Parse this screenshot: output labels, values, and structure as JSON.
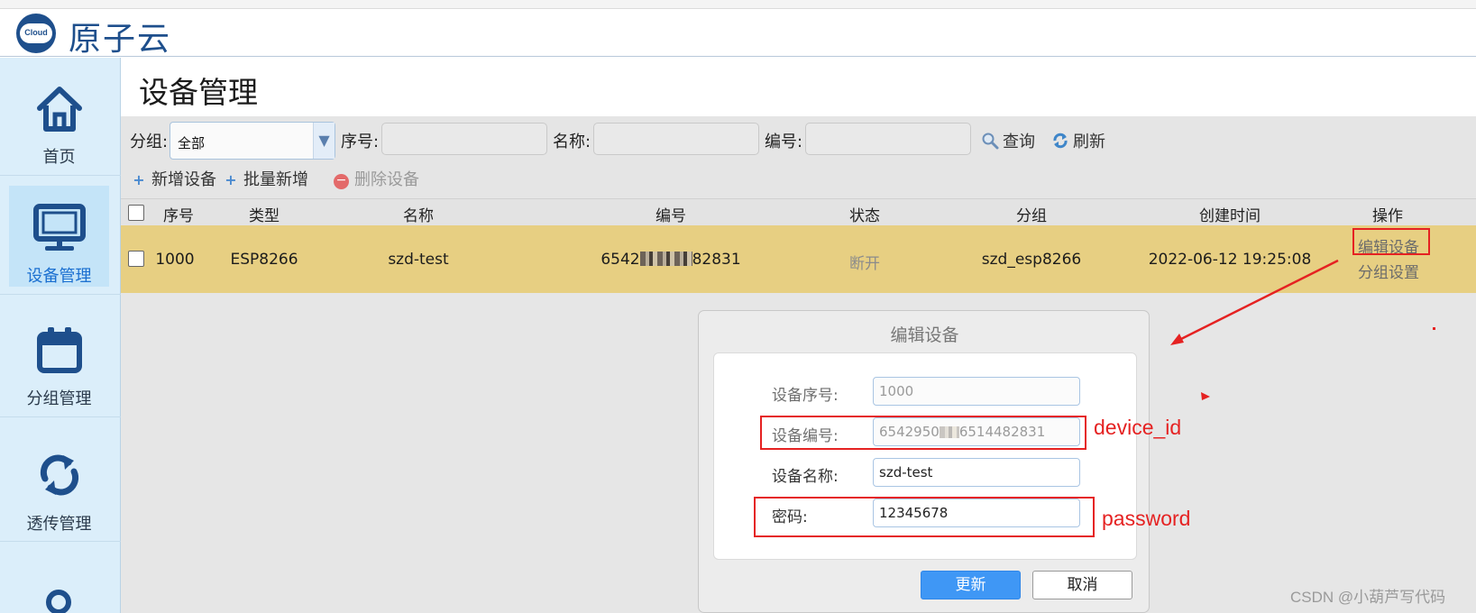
{
  "header": {
    "brand": "原子云",
    "logo_text": "Cloud"
  },
  "sidebar": {
    "items": [
      {
        "label": "首页",
        "icon": "home-icon",
        "active": false
      },
      {
        "label": "设备管理",
        "icon": "monitor-icon",
        "active": true
      },
      {
        "label": "分组管理",
        "icon": "calendar-icon",
        "active": false
      },
      {
        "label": "透传管理",
        "icon": "sync-icon",
        "active": false
      }
    ]
  },
  "page": {
    "title": "设备管理"
  },
  "filters": {
    "group_label": "分组:",
    "group_value": "全部",
    "serial_label": "序号:",
    "name_label": "名称:",
    "code_label": "编号:",
    "search_label": "查询",
    "refresh_label": "刷新"
  },
  "actions": {
    "add_label": "新增设备",
    "batch_add_label": "批量新增",
    "delete_label": "删除设备"
  },
  "table": {
    "columns": [
      "序号",
      "类型",
      "名称",
      "编号",
      "状态",
      "分组",
      "创建时间",
      "操作"
    ],
    "rows": [
      {
        "serial": "1000",
        "type": "ESP8266",
        "name": "szd-test",
        "code_prefix": "6542",
        "code_suffix": "82831",
        "status": "断开",
        "group": "szd_esp8266",
        "created": "2022-06-12 19:25:08",
        "op_edit": "编辑设备",
        "op_group": "分组设置"
      }
    ]
  },
  "dialog": {
    "title": "编辑设备",
    "fields": {
      "serial_label": "设备序号:",
      "serial_value": "1000",
      "code_label": "设备编号:",
      "code_value_prefix": "6542950",
      "code_value_suffix": "6514482831",
      "name_label": "设备名称:",
      "name_value": "szd-test",
      "password_label": "密码:",
      "password_value": "12345678"
    },
    "update_label": "更新",
    "cancel_label": "取消"
  },
  "annotations": {
    "device_id": "device_id",
    "password": "password",
    "color": "#e52222"
  },
  "watermark": "CSDN @小葫芦写代码",
  "colors": {
    "brand": "#1e4f8c",
    "sidebar_bg": "#dbeefa",
    "active_nav": "#1a6fd0",
    "selected_row": "#e7cf82",
    "primary_button": "#3f97f5"
  }
}
